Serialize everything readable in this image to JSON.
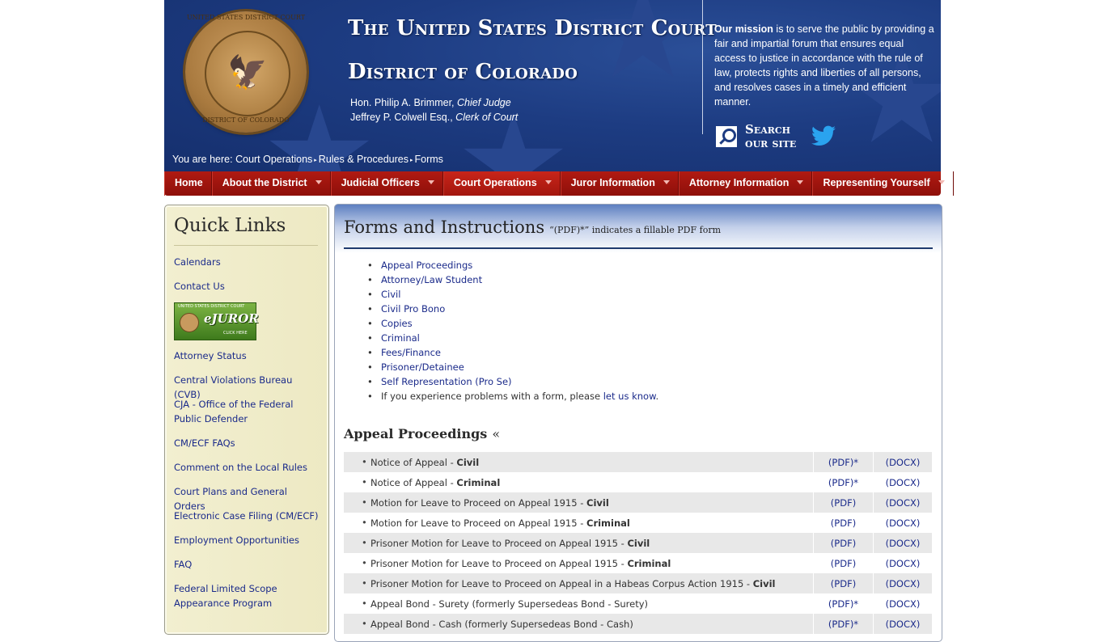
{
  "header": {
    "title_line1": "The United States District Court",
    "title_line2": "District of Colorado",
    "seal_text_top": "UNITED STATES DISTRICT COURT",
    "seal_text_bottom": "DISTRICT OF COLORADO",
    "officers": [
      {
        "name": "Hon. Philip A. Brimmer,",
        "role": "Chief Judge"
      },
      {
        "name": "Jeffrey P. Colwell Esq.,",
        "role": "Clerk of Court"
      }
    ],
    "mission_bold": "Our mission",
    "mission_text": " is to serve the public by providing a fair and impartial forum that ensures equal access to justice in accordance with the rule of law, protects rights and liberties of all persons, and resolves cases in a timely and efficient manner.",
    "search_line1": "Search",
    "search_line2": "our site",
    "breadcrumb": {
      "prefix": "You are here:",
      "items": [
        "Court Operations",
        "Rules & Procedures",
        "Forms"
      ]
    }
  },
  "nav": {
    "items": [
      {
        "label": "Home",
        "dropdown": false
      },
      {
        "label": "About the District",
        "dropdown": true
      },
      {
        "label": "Judicial Officers",
        "dropdown": true
      },
      {
        "label": "Court Operations",
        "dropdown": true,
        "active": true
      },
      {
        "label": "Juror Information",
        "dropdown": true
      },
      {
        "label": "Attorney Information",
        "dropdown": true
      },
      {
        "label": "Representing Yourself",
        "dropdown": true
      }
    ]
  },
  "sidebar": {
    "title": "Quick Links",
    "items": [
      "Calendars",
      "Contact Us",
      "Attorney Status",
      "Central Violations Bureau (CVB)",
      "CJA - Office of the Federal Public Defender",
      "CM/ECF FAQs",
      "Comment on the Local Rules",
      "Court Plans and General Orders",
      "Electronic Case Filing (CM/ECF)",
      "Employment Opportunities",
      "FAQ",
      "Federal Limited Scope Appearance Program"
    ],
    "ejuror": {
      "top": "UNITED STATES DISTRICT COURT",
      "label": "eJUROR",
      "click": "CLICK HERE"
    }
  },
  "main": {
    "title": "Forms and Instructions",
    "note": "“(PDF)*” indicates a fillable PDF form",
    "toc": [
      "Appeal Proceedings",
      "Attorney/Law Student",
      "Civil",
      "Civil Pro Bono",
      "Copies",
      "Criminal",
      "Fees/Finance",
      "Prisoner/Detainee",
      "Self Representation (Pro Se)"
    ],
    "problem_text": "If you experience problems with a form, please ",
    "problem_link": "let us know",
    "problem_end": ".",
    "section_title": "Appeal Proceedings",
    "section_arrow": "«",
    "forms": [
      {
        "name": "Notice of Appeal - ",
        "bold": "Civil",
        "pdf": "(PDF)*",
        "docx": "(DOCX)"
      },
      {
        "name": "Notice of Appeal - ",
        "bold": "Criminal",
        "pdf": "(PDF)*",
        "docx": "(DOCX)"
      },
      {
        "name": "Motion for Leave to Proceed on Appeal 1915 - ",
        "bold": "Civil",
        "pdf": "(PDF)",
        "docx": "(DOCX)"
      },
      {
        "name": "Motion for Leave to Proceed on Appeal 1915 - ",
        "bold": "Criminal",
        "pdf": "(PDF)",
        "docx": "(DOCX)"
      },
      {
        "name": "Prisoner Motion for Leave to Proceed on Appeal 1915 - ",
        "bold": "Civil",
        "pdf": "(PDF)",
        "docx": "(DOCX)"
      },
      {
        "name": "Prisoner Motion for Leave to Proceed on Appeal 1915 - ",
        "bold": "Criminal",
        "pdf": "(PDF)",
        "docx": "(DOCX)"
      },
      {
        "name": "Prisoner Motion for Leave to Proceed on Appeal in a Habeas Corpus Action 1915 - ",
        "bold": "Civil",
        "pdf": "(PDF)",
        "docx": "(DOCX)"
      },
      {
        "name": "Appeal Bond - Surety (formerly Supersedeas Bond - Surety)",
        "bold": "",
        "pdf": "(PDF)*",
        "docx": "(DOCX)"
      },
      {
        "name": "Appeal Bond - Cash (formerly Supersedeas Bond - Cash)",
        "bold": "",
        "pdf": "(PDF)*",
        "docx": "(DOCX)"
      }
    ]
  },
  "colors": {
    "header_blue": "#1d3c82",
    "nav_red": "#a3160e",
    "link_blue": "#1a2a8a",
    "sidebar_bg": "#efecc8",
    "twitter": "#2aa3ef"
  }
}
